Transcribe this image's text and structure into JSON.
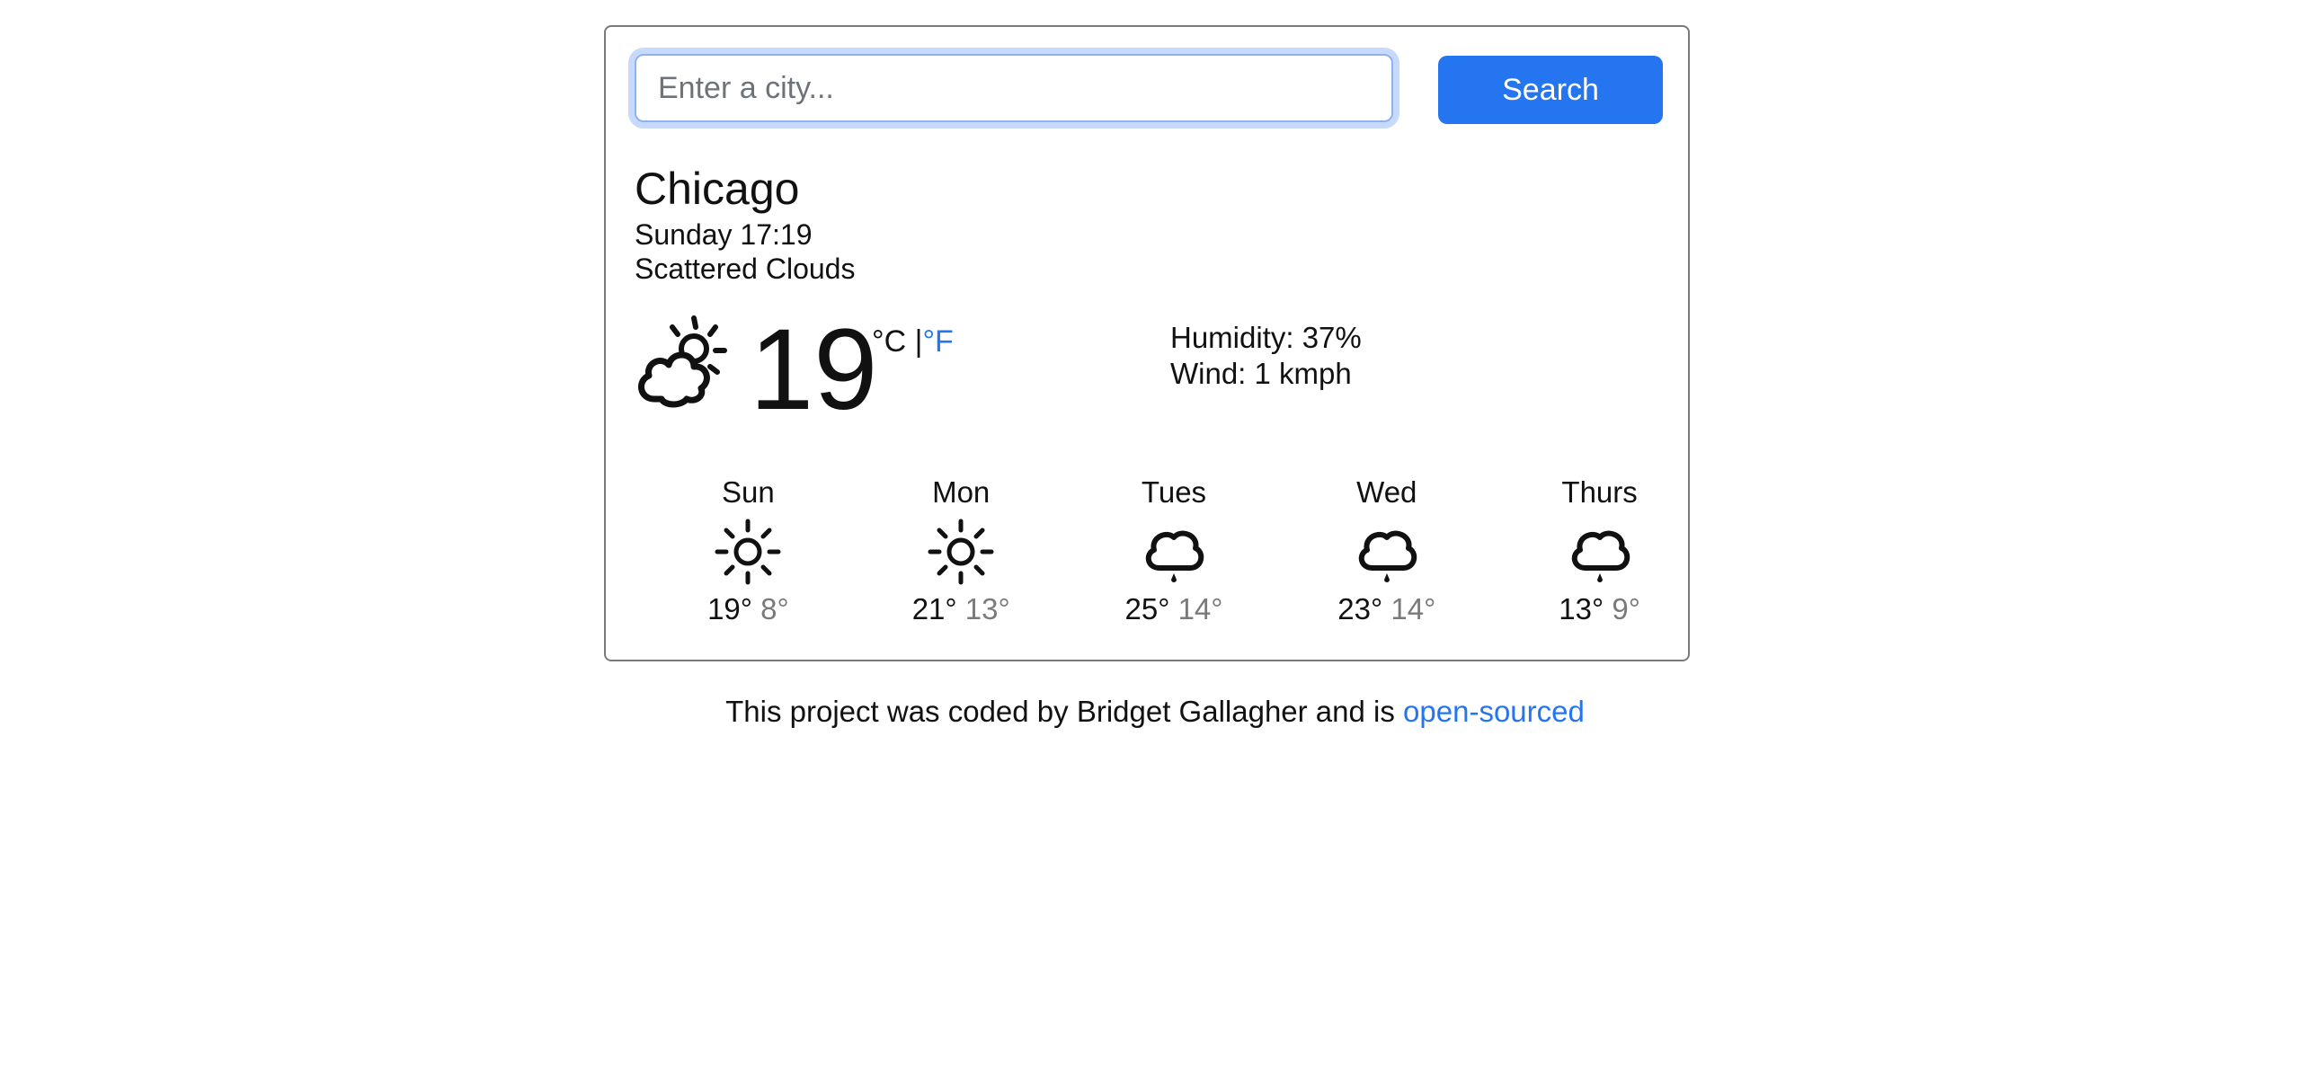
{
  "search": {
    "placeholder": "Enter a city...",
    "value": "",
    "button_label": "Search"
  },
  "current": {
    "city": "Chicago",
    "datetime": "Sunday 17:19",
    "description": "Scattered Clouds",
    "icon": "partly-cloudy-icon",
    "temperature": "19",
    "unit_c": "°C",
    "unit_separator": " |",
    "unit_f": "°F",
    "humidity": "Humidity: 37%",
    "wind": "Wind: 1 kmph"
  },
  "forecast": [
    {
      "day": "Sun",
      "icon": "sun-icon",
      "max": "19°",
      "min": "8°"
    },
    {
      "day": "Mon",
      "icon": "sun-icon",
      "max": "21°",
      "min": "13°"
    },
    {
      "day": "Tues",
      "icon": "rain-cloud-icon",
      "max": "25°",
      "min": "14°"
    },
    {
      "day": "Wed",
      "icon": "rain-cloud-icon",
      "max": "23°",
      "min": "14°"
    },
    {
      "day": "Thurs",
      "icon": "rain-cloud-icon",
      "max": "13°",
      "min": "9°"
    }
  ],
  "footer": {
    "text": "This project was coded by Bridget Gallagher and is ",
    "link_label": "open-sourced"
  },
  "colors": {
    "accent": "#2675f0",
    "muted_temp": "#7a7a7a",
    "border": "#7a7a7a"
  }
}
